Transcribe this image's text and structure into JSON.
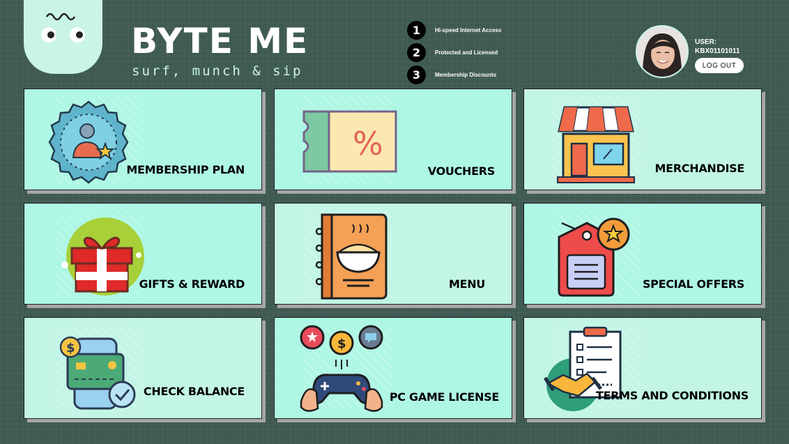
{
  "brand": {
    "title": "BYTE ME",
    "tagline": "surf, munch & sip"
  },
  "features": [
    {
      "number": "1",
      "text": "Hi-speed Internet Access"
    },
    {
      "number": "2",
      "text": "Protected and Licensed"
    },
    {
      "number": "3",
      "text": "Membership Discounts"
    }
  ],
  "user": {
    "label": "USER:",
    "id": "KBX01101011",
    "logout_label": "LOG OUT"
  },
  "tiles": [
    {
      "label": "MEMBERSHIP PLAN",
      "icon": "membership-badge-icon"
    },
    {
      "label": "VOUCHERS",
      "icon": "voucher-ticket-icon"
    },
    {
      "label": "MERCHANDISE",
      "icon": "store-icon"
    },
    {
      "label": "GIFTS & REWARD",
      "icon": "gift-box-icon"
    },
    {
      "label": "MENU",
      "icon": "menu-book-icon"
    },
    {
      "label": "SPECIAL OFFERS",
      "icon": "price-tag-icon"
    },
    {
      "label": "CHECK BALANCE",
      "icon": "wallet-card-icon"
    },
    {
      "label": "PC GAME LICENSE",
      "icon": "game-controller-icon"
    },
    {
      "label": "TERMS AND CONDITIONS",
      "icon": "contract-handshake-icon"
    }
  ],
  "colors": {
    "background": "#3f5a52",
    "tile": "#aef7e4",
    "tile_pale": "#c2f5e5",
    "accent": "#c9f4e6"
  }
}
